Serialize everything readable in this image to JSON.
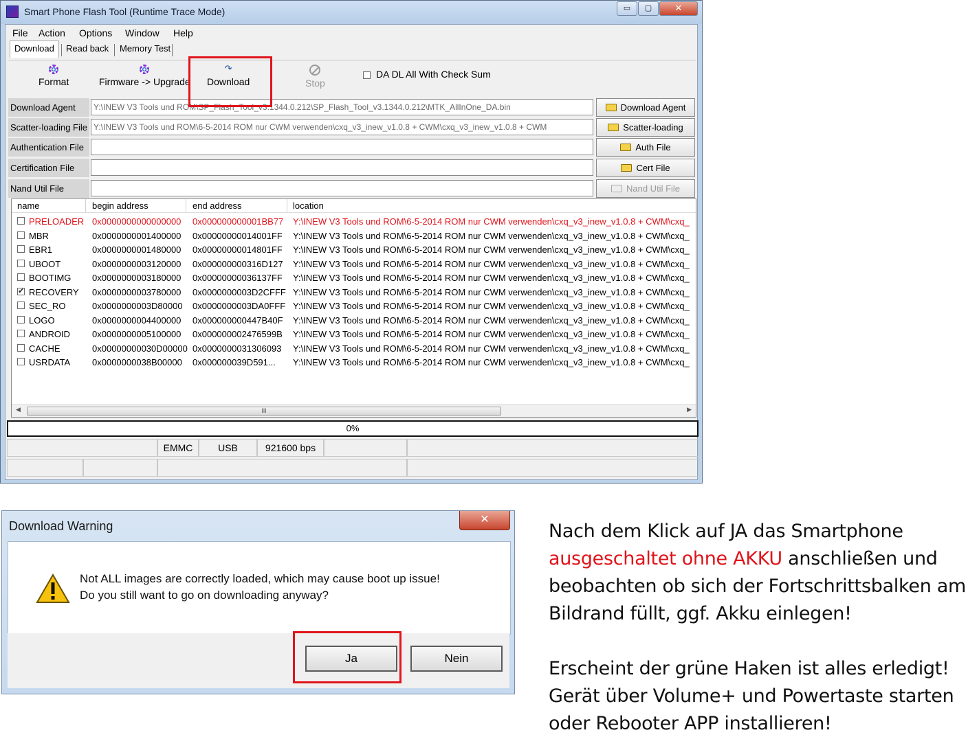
{
  "window": {
    "title": "Smart Phone Flash Tool (Runtime Trace Mode)",
    "controls": {
      "minimize": "▭",
      "maximize": "▢",
      "close": "✕"
    }
  },
  "menu": [
    "File",
    "Action",
    "Options",
    "Window",
    "Help"
  ],
  "tabs": [
    "Download",
    "Read back",
    "Memory Test"
  ],
  "toolbar": {
    "format": "Format",
    "firmware_upgrade": "Firmware -> Upgrade",
    "download": "Download",
    "stop": "Stop",
    "checksum_label": "DA DL All With Check Sum",
    "checksum_checked": false
  },
  "files": [
    {
      "label": "Download Agent",
      "value": "Y:\\INEW V3 Tools und ROM\\SP_Flash_Tool_v3.1344.0.212\\SP_Flash_Tool_v3.1344.0.212\\MTK_AllInOne_DA.bin",
      "button": "Download Agent",
      "enabled": true
    },
    {
      "label": "Scatter-loading File",
      "value": "Y:\\INEW V3 Tools und ROM\\6-5-2014 ROM nur CWM verwenden\\cxq_v3_inew_v1.0.8 + CWM\\cxq_v3_inew_v1.0.8 + CWM",
      "button": "Scatter-loading",
      "enabled": true
    },
    {
      "label": "Authentication File",
      "value": "",
      "button": "Auth File",
      "enabled": true
    },
    {
      "label": "Certification File",
      "value": "",
      "button": "Cert File",
      "enabled": true
    },
    {
      "label": "Nand Util File",
      "value": "",
      "button": "Nand Util File",
      "enabled": false
    }
  ],
  "table": {
    "columns": [
      "name",
      "begin address",
      "end address",
      "location"
    ],
    "rows": [
      {
        "name": "PRELOADER",
        "begin": "0x0000000000000000",
        "end": "0x000000000001BB77",
        "location": "Y:\\INEW V3 Tools und ROM\\6-5-2014 ROM nur CWM verwenden\\cxq_v3_inew_v1.0.8 + CWM\\cxq_",
        "checked": false,
        "highlight": true
      },
      {
        "name": "MBR",
        "begin": "0x0000000001400000",
        "end": "0x00000000014001FF",
        "location": "Y:\\INEW V3 Tools und ROM\\6-5-2014 ROM nur CWM verwenden\\cxq_v3_inew_v1.0.8 + CWM\\cxq_",
        "checked": false,
        "highlight": false
      },
      {
        "name": "EBR1",
        "begin": "0x0000000001480000",
        "end": "0x00000000014801FF",
        "location": "Y:\\INEW V3 Tools und ROM\\6-5-2014 ROM nur CWM verwenden\\cxq_v3_inew_v1.0.8 + CWM\\cxq_",
        "checked": false,
        "highlight": false
      },
      {
        "name": "UBOOT",
        "begin": "0x0000000003120000",
        "end": "0x000000000316D127",
        "location": "Y:\\INEW V3 Tools und ROM\\6-5-2014 ROM nur CWM verwenden\\cxq_v3_inew_v1.0.8 + CWM\\cxq_",
        "checked": false,
        "highlight": false
      },
      {
        "name": "BOOTIMG",
        "begin": "0x0000000003180000",
        "end": "0x00000000036137FF",
        "location": "Y:\\INEW V3 Tools und ROM\\6-5-2014 ROM nur CWM verwenden\\cxq_v3_inew_v1.0.8 + CWM\\cxq_",
        "checked": false,
        "highlight": false
      },
      {
        "name": "RECOVERY",
        "begin": "0x0000000003780000",
        "end": "0x0000000003D2CFFF",
        "location": "Y:\\INEW V3 Tools und ROM\\6-5-2014 ROM nur CWM verwenden\\cxq_v3_inew_v1.0.8 + CWM\\cxq_",
        "checked": true,
        "highlight": false
      },
      {
        "name": "SEC_RO",
        "begin": "0x0000000003D80000",
        "end": "0x0000000003DA0FFF",
        "location": "Y:\\INEW V3 Tools und ROM\\6-5-2014 ROM nur CWM verwenden\\cxq_v3_inew_v1.0.8 + CWM\\cxq_",
        "checked": false,
        "highlight": false
      },
      {
        "name": "LOGO",
        "begin": "0x0000000004400000",
        "end": "0x000000000447B40F",
        "location": "Y:\\INEW V3 Tools und ROM\\6-5-2014 ROM nur CWM verwenden\\cxq_v3_inew_v1.0.8 + CWM\\cxq_",
        "checked": false,
        "highlight": false
      },
      {
        "name": "ANDROID",
        "begin": "0x0000000005100000",
        "end": "0x000000002476599B",
        "location": "Y:\\INEW V3 Tools und ROM\\6-5-2014 ROM nur CWM verwenden\\cxq_v3_inew_v1.0.8 + CWM\\cxq_",
        "checked": false,
        "highlight": false
      },
      {
        "name": "CACHE",
        "begin": "0x00000000030D00000",
        "end": "0x0000000031306093",
        "location": "Y:\\INEW V3 Tools und ROM\\6-5-2014 ROM nur CWM verwenden\\cxq_v3_inew_v1.0.8 + CWM\\cxq_",
        "checked": false,
        "highlight": false
      },
      {
        "name": "USRDATA",
        "begin": "0x0000000038B00000",
        "end": "0x000000039D591...",
        "location": "Y:\\INEW V3 Tools und ROM\\6-5-2014 ROM nur CWM verwenden\\cxq_v3_inew_v1.0.8 + CWM\\cxq_",
        "checked": false,
        "highlight": false
      }
    ],
    "scroll_thumb": "III"
  },
  "progress": {
    "label": "0%",
    "value": 0
  },
  "status": {
    "storage": "EMMC",
    "port": "USB",
    "baud": "921600 bps"
  },
  "dialog": {
    "title": "Download Warning",
    "close": "✕",
    "message_line1": "Not ALL images are correctly loaded, which may cause boot up issue!",
    "message_line2": "Do you still want to go on downloading anyway?",
    "yes": "Ja",
    "no": "Nein"
  },
  "note": {
    "p1_before": "Nach dem Klick auf JA das Smartphone",
    "p1_red": "ausgeschaltet ohne AKKU",
    "p1_after": " anschließen und beobachten ob sich der Fortschrittsbalken am Bildrand füllt, ggf. Akku einlegen!",
    "p2": "Erscheint der grüne Haken ist alles erledigt! Gerät über Volume+ und Powertaste starten oder Rebooter APP installieren!"
  },
  "colors": {
    "highlight": "#e0141b",
    "titlebar": "#c3d7ee"
  }
}
